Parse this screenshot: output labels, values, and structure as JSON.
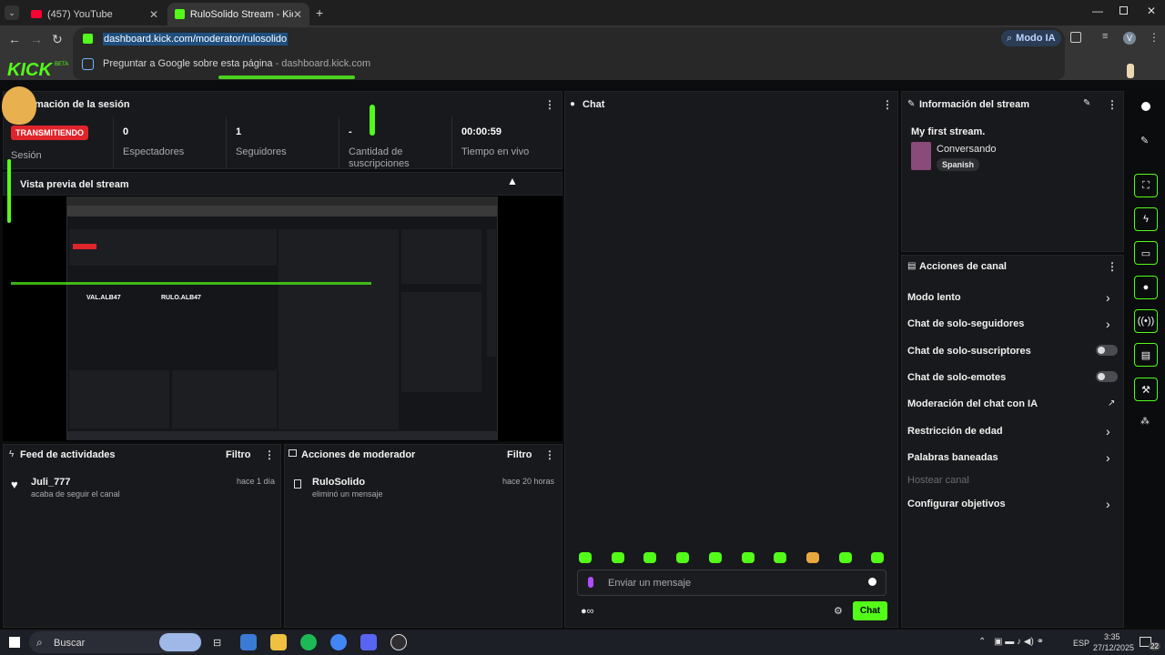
{
  "tabs": [
    {
      "label": "(457) YouTube",
      "icon_color": "#ff0033"
    },
    {
      "label": "RuloSolido Stream - Kick Dashb",
      "icon_color": "#53fc18"
    }
  ],
  "address": {
    "url": "dashboard.kick.com/moderator/rulosolido",
    "suggestion": "Preguntar a Google sobre esta página",
    "suggestion_domain": " - dashboard.kick.com",
    "modo_ia": "Modo IA",
    "profile_initial": "V"
  },
  "brand": {
    "logo": "KICK",
    "beta": "BETA"
  },
  "session": {
    "title": "Información de la sesión",
    "title_visible": "mación de la sesión",
    "status": "TRANSMITIENDO",
    "status_label": "Sesión",
    "stats": [
      {
        "value": "0",
        "label": "Espectadores"
      },
      {
        "value": "1",
        "label": "Seguidores"
      },
      {
        "value": "-",
        "label": "Cantidad de suscripciones"
      },
      {
        "value": "00:00:59",
        "label": "Tiempo en vivo"
      }
    ]
  },
  "preview": {
    "title": "Vista previa del stream",
    "labels": [
      "VAL.ALB47",
      "RULO.ALB47"
    ]
  },
  "chat": {
    "title": "Chat",
    "placeholder": "Enviar un mensaje",
    "send": "Chat"
  },
  "stream_info": {
    "title": "Información del stream",
    "name": "My first stream.",
    "category": "Conversando",
    "language": "Spanish"
  },
  "channel_actions": {
    "title": "Acciones de canal",
    "items": [
      {
        "label": "Modo lento",
        "control": "chevron"
      },
      {
        "label": "Chat de solo-seguidores",
        "control": "chevron"
      },
      {
        "label": "Chat de solo-suscriptores",
        "control": "toggle"
      },
      {
        "label": "Chat de solo-emotes",
        "control": "toggle"
      },
      {
        "label": "Moderación del chat con IA",
        "control": "external"
      },
      {
        "label": "Restricción de edad",
        "control": "chevron"
      },
      {
        "label": "Palabras baneadas",
        "control": "chevron"
      },
      {
        "label": "Hostear canal",
        "control": "disabled"
      },
      {
        "label": "Configurar objetivos",
        "control": "chevron"
      }
    ]
  },
  "activity": {
    "title": "Feed de actividades",
    "filter": "Filtro",
    "user": "Juli_777",
    "text": "acaba de seguir el canal",
    "time": "hace 1 día"
  },
  "modactions": {
    "title": "Acciones de moderador",
    "filter": "Filtro",
    "user": "RuloSolido",
    "text": "eliminó un mensaje",
    "time": "hace 20 horas"
  },
  "taskbar": {
    "search": "Buscar",
    "lang": "ESP",
    "time": "3:35",
    "date": "27/12/2025",
    "notif": "22"
  },
  "colors": {
    "accent": "#53fc18",
    "live": "#e0242b"
  }
}
